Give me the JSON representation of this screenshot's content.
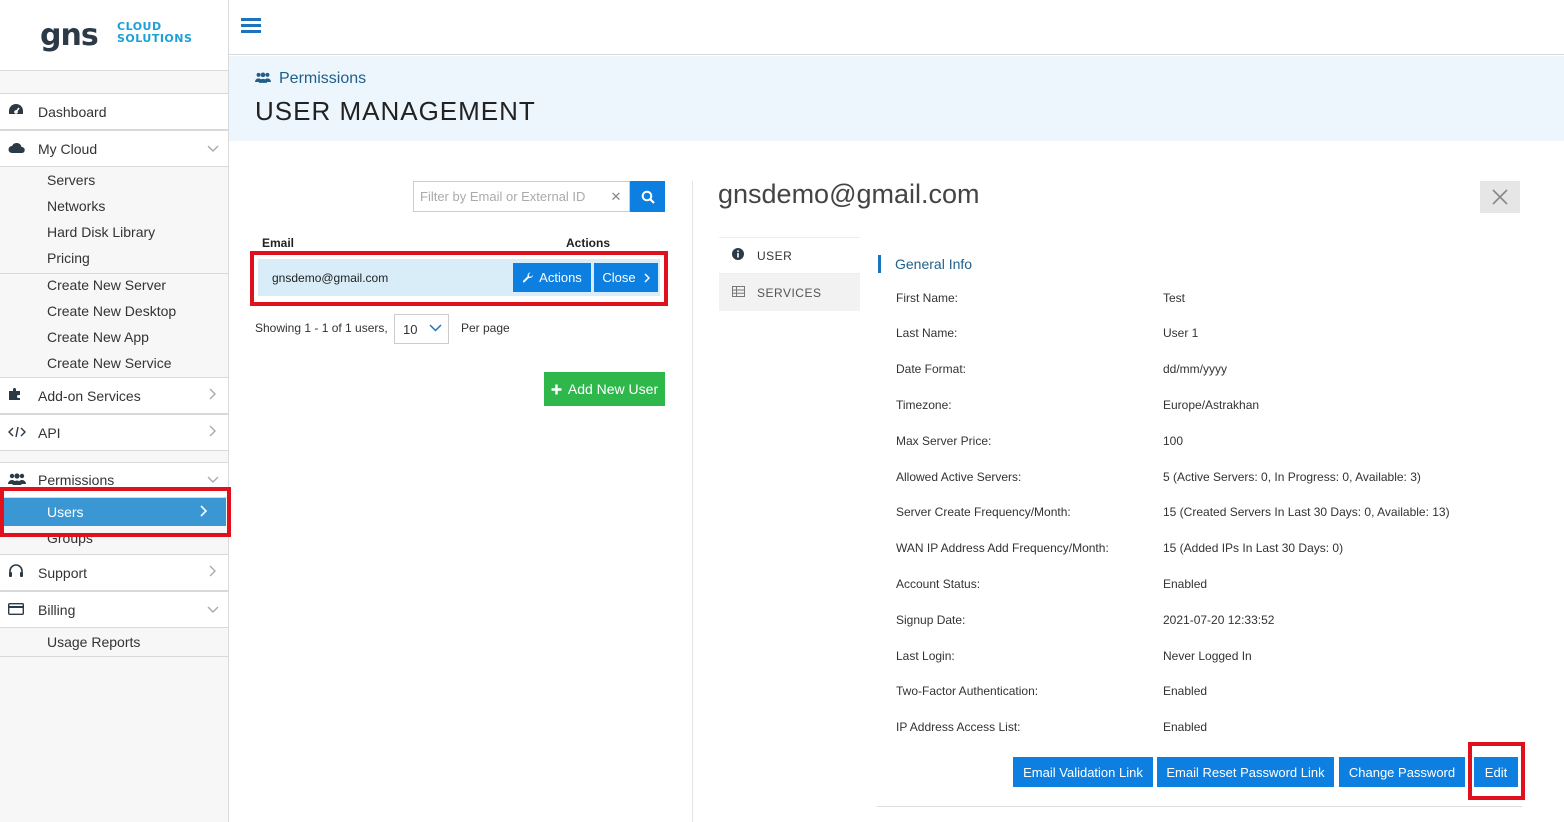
{
  "logo": {
    "main": "gns",
    "sub_line1": "CLOUD",
    "sub_line2": "SOLUTIONS"
  },
  "sidebar": {
    "dashboard": "Dashboard",
    "my_cloud": "My Cloud",
    "my_cloud_items": [
      "Servers",
      "Networks",
      "Hard Disk Library",
      "Pricing"
    ],
    "create_items": [
      "Create New Server",
      "Create New Desktop",
      "Create New App",
      "Create New Service"
    ],
    "addon": "Add-on Services",
    "api": "API",
    "permissions": "Permissions",
    "users": "Users",
    "groups": "Groups",
    "support": "Support",
    "billing": "Billing",
    "usage_reports": "Usage Reports"
  },
  "header": {
    "breadcrumb": "Permissions",
    "title": "USER MANAGEMENT"
  },
  "filter": {
    "placeholder": "Filter by Email or External ID",
    "value": ""
  },
  "table": {
    "col_email": "Email",
    "col_actions": "Actions",
    "row_email": "gnsdemo@gmail.com",
    "actions_label": "Actions",
    "close_label": "Close"
  },
  "paging": {
    "showing": "Showing 1 - 1 of 1 users,",
    "per_page_value": "10",
    "per_page_label": "Per page"
  },
  "add_user_label": "Add New User",
  "detail": {
    "email": "gnsdemo@gmail.com",
    "tab_user": "USER",
    "tab_services": "SERVICES",
    "section_title": "General Info",
    "fields": [
      {
        "label": "First Name:",
        "value": "Test"
      },
      {
        "label": "Last Name:",
        "value": "User 1"
      },
      {
        "label": "Date Format:",
        "value": "dd/mm/yyyy"
      },
      {
        "label": "Timezone:",
        "value": "Europe/Astrakhan"
      },
      {
        "label": "Max Server Price:",
        "value": "100"
      },
      {
        "label": "Allowed Active Servers:",
        "value": "5 (Active Servers: 0, In Progress: 0, Available: 3)"
      },
      {
        "label": "Server Create Frequency/Month:",
        "value": "15 (Created Servers In Last 30 Days: 0, Available: 13)"
      },
      {
        "label": "WAN IP Address Add Frequency/Month:",
        "value": "15 (Added IPs In Last 30 Days: 0)"
      },
      {
        "label": "Account Status:",
        "value": "Enabled"
      },
      {
        "label": "Signup Date:",
        "value": "2021-07-20 12:33:52"
      },
      {
        "label": "Last Login:",
        "value": "Never Logged In"
      },
      {
        "label": "Two-Factor Authentication:",
        "value": "Enabled"
      },
      {
        "label": "IP Address Access List:",
        "value": "Enabled"
      }
    ],
    "buttons": {
      "email_validation": "Email Validation Link",
      "email_reset": "Email Reset Password Link",
      "change_password": "Change Password",
      "edit": "Edit"
    }
  },
  "colors": {
    "accent": "#0d7fe0",
    "active_nav": "#3a97d4",
    "add_button": "#2eb84c",
    "highlight": "#e0101c"
  }
}
